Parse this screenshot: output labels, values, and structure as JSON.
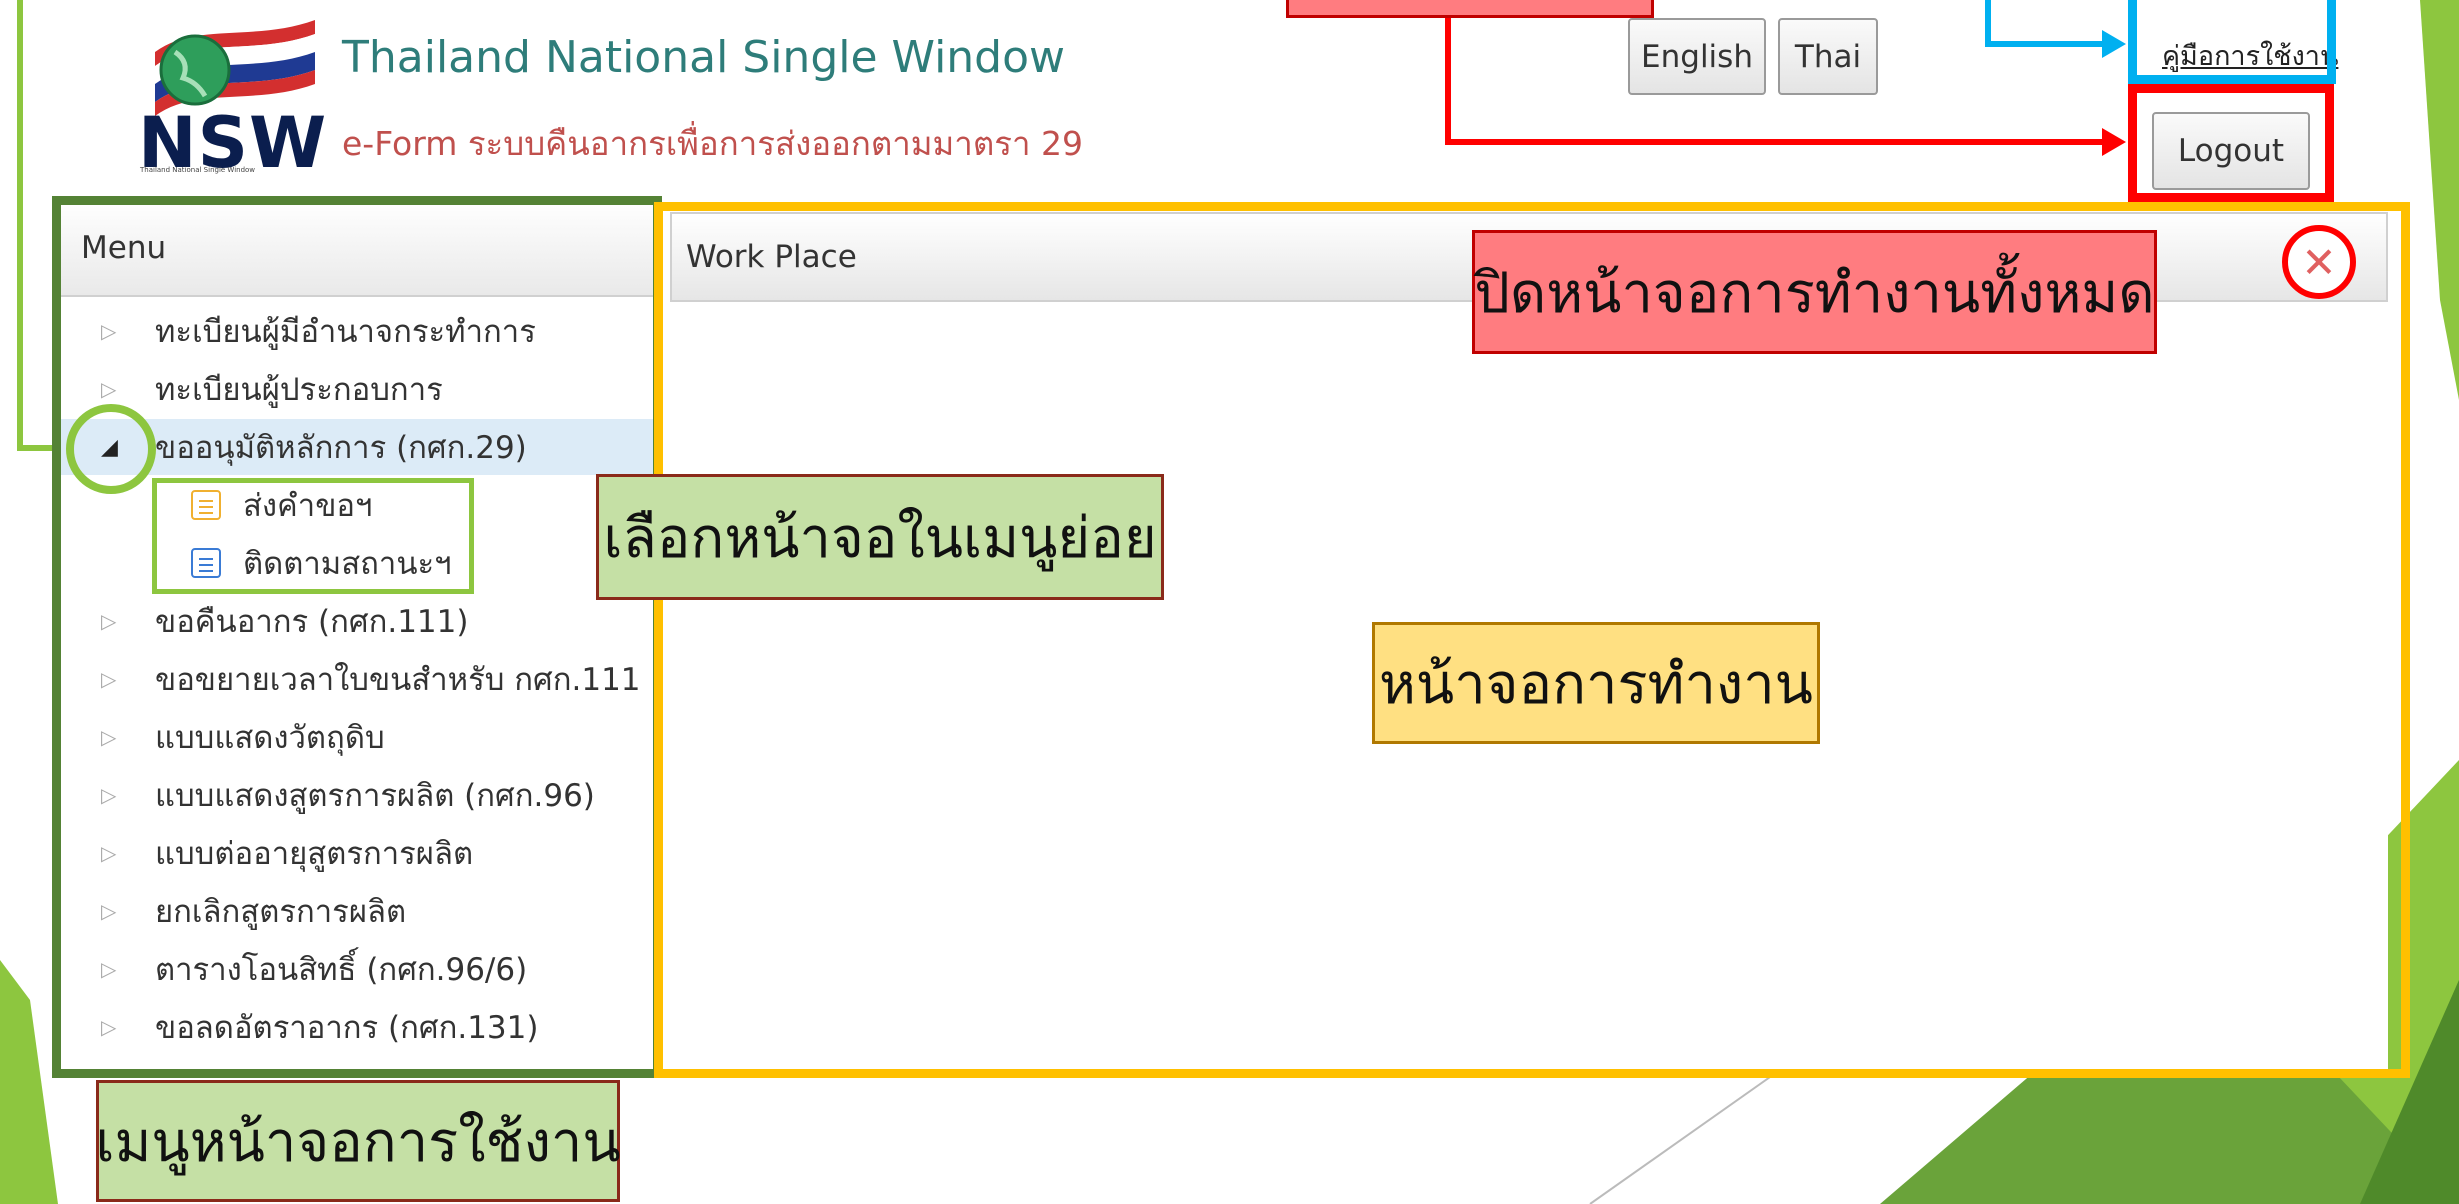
{
  "header": {
    "logo_text": "NSW",
    "logo_subtext": "Thailand National Single Window",
    "title": "Thailand National Single Window",
    "subtitle": "e-Form ระบบคืนอากรเพื่อการส่งออกตามมาตรา 29",
    "lang_english": "English",
    "lang_thai": "Thai",
    "manual_link": "คู่มือการใช้งาน",
    "logout": "Logout"
  },
  "menu": {
    "title": "Menu",
    "items": [
      {
        "label": "ทะเบียนผู้มีอำนาจกระทำการ",
        "expanded": false
      },
      {
        "label": "ทะเบียนผู้ประกอบการ",
        "expanded": false
      },
      {
        "label": "ขออนุมัติหลักการ (กศก.29)",
        "expanded": true
      },
      {
        "label": "ขอคืนอากร (กศก.111)",
        "expanded": false
      },
      {
        "label": "ขอขยายเวลาใบขนสำหรับ กศก.111",
        "expanded": false
      },
      {
        "label": "แบบแสดงวัตถุดิบ",
        "expanded": false
      },
      {
        "label": "แบบแสดงสูตรการผลิต (กศก.96)",
        "expanded": false
      },
      {
        "label": "แบบต่ออายุสูตรการผลิต",
        "expanded": false
      },
      {
        "label": "ยกเลิกสูตรการผลิต",
        "expanded": false
      },
      {
        "label": "ตารางโอนสิทธิ์ (กศก.96/6)",
        "expanded": false
      },
      {
        "label": "ขอลดอัตราอากร (กศก.131)",
        "expanded": false
      }
    ],
    "subitems": [
      {
        "label": "ส่งคำขอฯ",
        "icon": "list-icon",
        "color": "#f0b030"
      },
      {
        "label": "ติดตามสถานะฯ",
        "icon": "list-icon",
        "color": "#3a7bd5"
      }
    ]
  },
  "workplace": {
    "title": "Work Place",
    "close_icon": "close-icon"
  },
  "annotations": {
    "close_all": "ปิดหน้าจอการทำงานทั้งหมด",
    "select_submenu": "เลือกหน้าจอในเมนูย่อย",
    "work_screen": "หน้าจอการทำงาน",
    "menu_screen": "เมนูหน้าจอการใช้งาน"
  },
  "colors": {
    "menu_frame": "#548235",
    "work_frame": "#ffc000",
    "manual_frame": "#00b0f0",
    "logout_frame": "#ff0000",
    "accent_green": "#8dc63f"
  }
}
